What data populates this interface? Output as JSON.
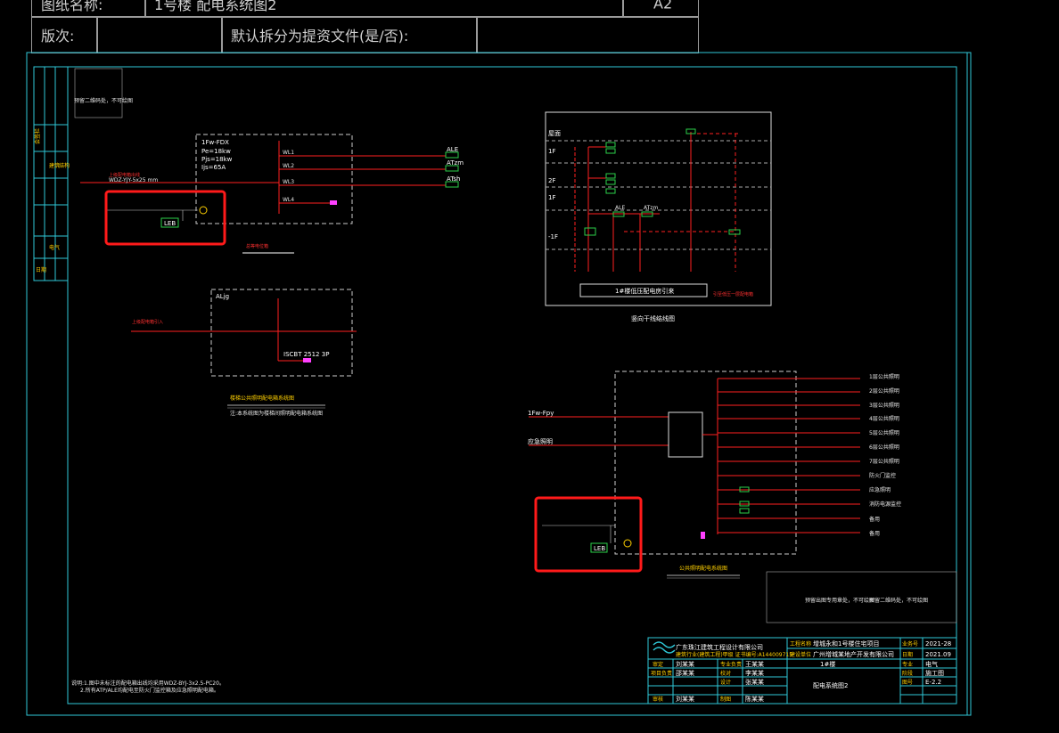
{
  "header": {
    "row1_label": "图纸名称:",
    "row1_value": "1号楼 配电系统图2",
    "row1_right": "A2",
    "row2_label": "版次:",
    "row2_prompt": "默认拆分为提资文件(是/否):"
  },
  "drawing": {
    "reserve_note_left": "预留二维码处，不可绘图",
    "reserve_note_bottom": "预留出图专用章处，不可绘图",
    "reserve_note_bottom2": "预留二维码处，不可绘图",
    "panel1": {
      "name": "1Fw-FDX",
      "pe": "Pe=18kw",
      "pjs": "Pjs=18kw",
      "ijs": "Ijs=65A",
      "feeders": [
        "WL1",
        "WL2",
        "WL3",
        "WL4"
      ],
      "incoming": "上级配电箱出线",
      "cable": "WDZ-YJY-5x25 mm",
      "leb": "LEB",
      "title": "总等电位箱",
      "loads": [
        "ALE",
        "ATzm",
        "ATsh"
      ]
    },
    "panel2": {
      "name": "ALjg",
      "incoming": "上级配电箱引入",
      "breaker": "ISCBT 2512 3P",
      "title": "楼梯公共照明配电箱系统图",
      "note": "注:本系统图为楼梯间照明配电箱系统图"
    },
    "riser": {
      "title": "竖向干线结线图",
      "floors": [
        "屋面",
        "1F",
        "2F",
        "1F",
        "-1F"
      ],
      "bottom_label": "1#楼低压配电房引来",
      "right_note": "引至低压一层配电箱",
      "labels": [
        "ALE",
        "ATzm"
      ]
    },
    "panel3": {
      "title": "公共照明配电系统图",
      "leb": "LEB",
      "incoming1": "1Fw-Fpy",
      "incoming2": "应急照明",
      "circuits": [
        "1层公共照明",
        "2层公共照明",
        "3层公共照明",
        "4层公共照明",
        "5层公共照明",
        "6层公共照明",
        "7层公共照明",
        "防火门监控",
        "应急照明",
        "消防电源监控",
        "备用",
        "备用"
      ]
    },
    "notes": [
      "说明:1.图中未标注的配电箱出线均采用WDZ-BYJ-3x2.5-PC20。",
      "2.所有ATP/ALE均配电至防火门监控箱及应急照明配电箱。"
    ]
  },
  "title_block": {
    "company": "广东珠江建筑工程设计有限公司",
    "cert": "建筑行业(建筑工程)甲级 证书编号:A144009715",
    "project_label": "工程名称",
    "project_value": "增城永和1号楼住宅项目",
    "client_label": "建设单位",
    "client_value": "广州增城某地产开发有限公司",
    "drawing_title": "配电系统图2",
    "rows": [
      {
        "k": "审定",
        "v": "刘某某"
      },
      {
        "k": "项目负责",
        "v": "邵某某"
      },
      {
        "k": "专业负责",
        "v": "王某某"
      },
      {
        "k": "校对",
        "v": "李某某"
      },
      {
        "k": "设计",
        "v": "张某某"
      },
      {
        "k": "审核",
        "v": "刘某某"
      },
      {
        "k": "制图",
        "v": "陈某某"
      }
    ],
    "job_no_label": "业务号",
    "job_no": "2021-28",
    "date_label": "日期",
    "date": "2021.09",
    "discipline_label": "专业",
    "discipline": "电气",
    "stage_label": "阶段",
    "stage": "施工图",
    "sheet_label": "图号",
    "sheet": "E-2.2",
    "sub_title": "1#楼"
  },
  "sidebar": {
    "labels": [
      "会签栏",
      "建筑",
      "结构",
      "电气",
      "日期"
    ]
  },
  "colors": {
    "frame": "#2fc8d8",
    "wire_red": "#ff2020",
    "highlight": "#ff1a1a",
    "text": "#e8e8e8",
    "green": "#2bd04a",
    "magenta": "#ff40ff",
    "yellow": "#ffd000"
  }
}
